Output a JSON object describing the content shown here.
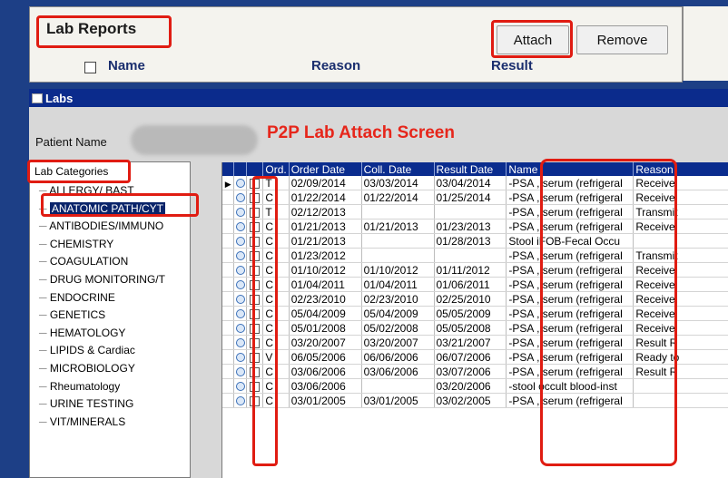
{
  "top_panel": {
    "title": "Lab Reports",
    "attach_label": "Attach",
    "remove_label": "Remove",
    "headers": {
      "name": "Name",
      "reason": "Reason",
      "result": "Result"
    }
  },
  "labs_window": {
    "title": "Labs",
    "patient_label": "Patient Name",
    "screen_title": "P2P Lab Attach Screen",
    "categories_header": "Lab Categories",
    "categories": [
      "ALLERGY/ BAST",
      "ANATOMIC PATH/CYT",
      "ANTIBODIES/IMMUNO",
      "CHEMISTRY",
      "COAGULATION",
      "DRUG MONITORING/T",
      "ENDOCRINE",
      "GENETICS",
      "HEMATOLOGY",
      "LIPIDS & Cardiac",
      "MICROBIOLOGY",
      "Rheumatology",
      "URINE TESTING",
      "VIT/MINERALS"
    ],
    "selected_category": 1
  },
  "grid": {
    "columns": [
      "",
      "",
      "",
      "Ord.",
      "Order Date",
      "Coll. Date",
      "Result Date",
      "Name",
      "Reason"
    ],
    "rows": [
      [
        "T",
        "02/09/2014",
        "03/03/2014",
        "03/04/2014",
        "-PSA , serum (refrigeral",
        "Receive"
      ],
      [
        "C",
        "01/22/2014",
        "01/22/2014",
        "01/25/2014",
        "-PSA , serum (refrigeral",
        "Receive"
      ],
      [
        "T",
        "02/12/2013",
        "",
        "",
        "-PSA , serum (refrigeral",
        "Transmit"
      ],
      [
        "C",
        "01/21/2013",
        "01/21/2013",
        "01/23/2013",
        "-PSA , serum (refrigeral",
        "Receive"
      ],
      [
        "C",
        "01/21/2013",
        "",
        "01/28/2013",
        "Stool iFOB-Fecal Occu",
        ""
      ],
      [
        "C",
        "01/23/2012",
        "",
        "",
        "-PSA , serum (refrigeral",
        "Transmit"
      ],
      [
        "C",
        "01/10/2012",
        "01/10/2012",
        "01/11/2012",
        "-PSA , serum (refrigeral",
        "Receive"
      ],
      [
        "C",
        "01/04/2011",
        "01/04/2011",
        "01/06/2011",
        "-PSA , serum (refrigeral",
        "Receive"
      ],
      [
        "C",
        "02/23/2010",
        "02/23/2010",
        "02/25/2010",
        "-PSA , serum (refrigeral",
        "Receive"
      ],
      [
        "C",
        "05/04/2009",
        "05/04/2009",
        "05/05/2009",
        "-PSA , serum (refrigeral",
        "Receive"
      ],
      [
        "C",
        "05/01/2008",
        "05/02/2008",
        "05/05/2008",
        "-PSA , serum (refrigeral",
        "Receive"
      ],
      [
        "C",
        "03/20/2007",
        "03/20/2007",
        "03/21/2007",
        "-PSA , serum (refrigeral",
        "Result R"
      ],
      [
        "V",
        "06/05/2006",
        "06/06/2006",
        "06/07/2006",
        "-PSA , serum (refrigeral",
        "Ready to"
      ],
      [
        "C",
        "03/06/2006",
        "03/06/2006",
        "03/07/2006",
        "-PSA , serum (refrigeral",
        "Result R"
      ],
      [
        "C",
        "03/06/2006",
        "",
        "03/20/2006",
        "-stool occult blood-inst",
        ""
      ],
      [
        "C",
        "03/01/2005",
        "03/01/2005",
        "03/02/2005",
        "-PSA , serum (refrigeral",
        ""
      ]
    ]
  },
  "colors": {
    "accent_red": "#e01c12",
    "grid_header": "#0a2c8e",
    "background": "#1d3f86"
  }
}
